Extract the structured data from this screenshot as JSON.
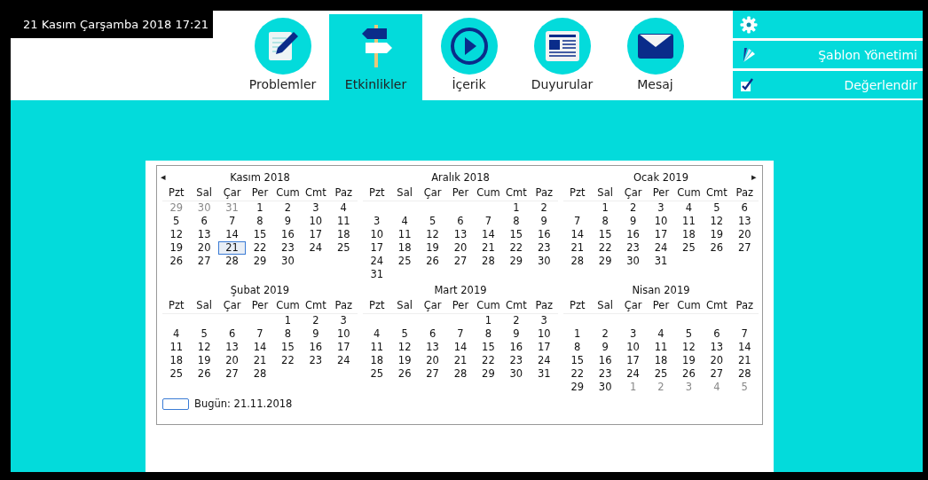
{
  "clock": "21 Kasım Çarşamba 2018 17:21",
  "tabs": [
    {
      "label": "Problemler",
      "kind": "pencil",
      "selected": false
    },
    {
      "label": "Etkinlikler",
      "kind": "signpost",
      "selected": true
    },
    {
      "label": "İçerik",
      "kind": "play",
      "selected": false
    },
    {
      "label": "Duyurular",
      "kind": "news",
      "selected": false
    },
    {
      "label": "Mesaj",
      "kind": "mail",
      "selected": false
    }
  ],
  "side_menu": [
    {
      "kind": "gear"
    },
    {
      "kind": "palette",
      "label": "Şablon Yönetimi"
    },
    {
      "kind": "check",
      "label": "Değerlendir"
    }
  ],
  "calendar": {
    "prev": "◂",
    "next": "▸",
    "today_label": "Bugün: 21.11.2018",
    "months": [
      {
        "title": "Kasım 2018",
        "weekdays": [
          "Pzt",
          "Sal",
          "Çar",
          "Per",
          "Cum",
          "Cmt",
          "Paz"
        ],
        "weeks": [
          {
            "cells": [
              {
                "day": "29",
                "kind": "other"
              },
              {
                "day": "30",
                "kind": "other"
              },
              {
                "day": "31",
                "kind": "other"
              },
              {
                "day": "1",
                "kind": "day"
              },
              {
                "day": "2",
                "kind": "day"
              },
              {
                "day": "3",
                "kind": "day"
              },
              {
                "day": "4",
                "kind": "day"
              }
            ]
          },
          {
            "cells": [
              {
                "day": "5",
                "kind": "day"
              },
              {
                "day": "6",
                "kind": "day"
              },
              {
                "day": "7",
                "kind": "day"
              },
              {
                "day": "8",
                "kind": "day"
              },
              {
                "day": "9",
                "kind": "day"
              },
              {
                "day": "10",
                "kind": "day"
              },
              {
                "day": "11",
                "kind": "day"
              }
            ]
          },
          {
            "cells": [
              {
                "day": "12",
                "kind": "day"
              },
              {
                "day": "13",
                "kind": "day"
              },
              {
                "day": "14",
                "kind": "day"
              },
              {
                "day": "15",
                "kind": "day"
              },
              {
                "day": "16",
                "kind": "day"
              },
              {
                "day": "17",
                "kind": "day"
              },
              {
                "day": "18",
                "kind": "day"
              }
            ]
          },
          {
            "cells": [
              {
                "day": "19",
                "kind": "day"
              },
              {
                "day": "20",
                "kind": "day"
              },
              {
                "day": "21",
                "kind": "today"
              },
              {
                "day": "22",
                "kind": "day"
              },
              {
                "day": "23",
                "kind": "day"
              },
              {
                "day": "24",
                "kind": "day"
              },
              {
                "day": "25",
                "kind": "day"
              }
            ]
          },
          {
            "cells": [
              {
                "day": "26",
                "kind": "day"
              },
              {
                "day": "27",
                "kind": "day"
              },
              {
                "day": "28",
                "kind": "day"
              },
              {
                "day": "29",
                "kind": "day"
              },
              {
                "day": "30",
                "kind": "day"
              },
              {
                "kind": "blank"
              },
              {
                "kind": "blank"
              }
            ]
          }
        ]
      },
      {
        "title": "Aralık 2018",
        "weekdays": [
          "Pzt",
          "Sal",
          "Çar",
          "Per",
          "Cum",
          "Cmt",
          "Paz"
        ],
        "weeks": [
          {
            "cells": [
              {
                "kind": "blank"
              },
              {
                "kind": "blank"
              },
              {
                "kind": "blank"
              },
              {
                "kind": "blank"
              },
              {
                "kind": "blank"
              },
              {
                "day": "1",
                "kind": "day"
              },
              {
                "day": "2",
                "kind": "day"
              }
            ]
          },
          {
            "cells": [
              {
                "day": "3",
                "kind": "day"
              },
              {
                "day": "4",
                "kind": "day"
              },
              {
                "day": "5",
                "kind": "day"
              },
              {
                "day": "6",
                "kind": "day"
              },
              {
                "day": "7",
                "kind": "day"
              },
              {
                "day": "8",
                "kind": "day"
              },
              {
                "day": "9",
                "kind": "day"
              }
            ]
          },
          {
            "cells": [
              {
                "day": "10",
                "kind": "day"
              },
              {
                "day": "11",
                "kind": "day"
              },
              {
                "day": "12",
                "kind": "day"
              },
              {
                "day": "13",
                "kind": "day"
              },
              {
                "day": "14",
                "kind": "day"
              },
              {
                "day": "15",
                "kind": "day"
              },
              {
                "day": "16",
                "kind": "day"
              }
            ]
          },
          {
            "cells": [
              {
                "day": "17",
                "kind": "day"
              },
              {
                "day": "18",
                "kind": "day"
              },
              {
                "day": "19",
                "kind": "day"
              },
              {
                "day": "20",
                "kind": "day"
              },
              {
                "day": "21",
                "kind": "day"
              },
              {
                "day": "22",
                "kind": "day"
              },
              {
                "day": "23",
                "kind": "day"
              }
            ]
          },
          {
            "cells": [
              {
                "day": "24",
                "kind": "day"
              },
              {
                "day": "25",
                "kind": "day"
              },
              {
                "day": "26",
                "kind": "day"
              },
              {
                "day": "27",
                "kind": "day"
              },
              {
                "day": "28",
                "kind": "day"
              },
              {
                "day": "29",
                "kind": "day"
              },
              {
                "day": "30",
                "kind": "day"
              }
            ]
          },
          {
            "cells": [
              {
                "day": "31",
                "kind": "day"
              },
              {
                "kind": "blank"
              },
              {
                "kind": "blank"
              },
              {
                "kind": "blank"
              },
              {
                "kind": "blank"
              },
              {
                "kind": "blank"
              },
              {
                "kind": "blank"
              }
            ]
          }
        ]
      },
      {
        "title": "Ocak 2019",
        "weekdays": [
          "Pzt",
          "Sal",
          "Çar",
          "Per",
          "Cum",
          "Cmt",
          "Paz"
        ],
        "weeks": [
          {
            "cells": [
              {
                "kind": "blank"
              },
              {
                "day": "1",
                "kind": "day"
              },
              {
                "day": "2",
                "kind": "day"
              },
              {
                "day": "3",
                "kind": "day"
              },
              {
                "day": "4",
                "kind": "day"
              },
              {
                "day": "5",
                "kind": "day"
              },
              {
                "day": "6",
                "kind": "day"
              }
            ]
          },
          {
            "cells": [
              {
                "day": "7",
                "kind": "day"
              },
              {
                "day": "8",
                "kind": "day"
              },
              {
                "day": "9",
                "kind": "day"
              },
              {
                "day": "10",
                "kind": "day"
              },
              {
                "day": "11",
                "kind": "day"
              },
              {
                "day": "12",
                "kind": "day"
              },
              {
                "day": "13",
                "kind": "day"
              }
            ]
          },
          {
            "cells": [
              {
                "day": "14",
                "kind": "day"
              },
              {
                "day": "15",
                "kind": "day"
              },
              {
                "day": "16",
                "kind": "day"
              },
              {
                "day": "17",
                "kind": "day"
              },
              {
                "day": "18",
                "kind": "day"
              },
              {
                "day": "19",
                "kind": "day"
              },
              {
                "day": "20",
                "kind": "day"
              }
            ]
          },
          {
            "cells": [
              {
                "day": "21",
                "kind": "day"
              },
              {
                "day": "22",
                "kind": "day"
              },
              {
                "day": "23",
                "kind": "day"
              },
              {
                "day": "24",
                "kind": "day"
              },
              {
                "day": "25",
                "kind": "day"
              },
              {
                "day": "26",
                "kind": "day"
              },
              {
                "day": "27",
                "kind": "day"
              }
            ]
          },
          {
            "cells": [
              {
                "day": "28",
                "kind": "day"
              },
              {
                "day": "29",
                "kind": "day"
              },
              {
                "day": "30",
                "kind": "day"
              },
              {
                "day": "31",
                "kind": "day"
              },
              {
                "kind": "blank"
              },
              {
                "kind": "blank"
              },
              {
                "kind": "blank"
              }
            ]
          }
        ]
      },
      {
        "title": "Şubat 2019",
        "weekdays": [
          "Pzt",
          "Sal",
          "Çar",
          "Per",
          "Cum",
          "Cmt",
          "Paz"
        ],
        "weeks": [
          {
            "cells": [
              {
                "kind": "blank"
              },
              {
                "kind": "blank"
              },
              {
                "kind": "blank"
              },
              {
                "kind": "blank"
              },
              {
                "day": "1",
                "kind": "day"
              },
              {
                "day": "2",
                "kind": "day"
              },
              {
                "day": "3",
                "kind": "day"
              }
            ]
          },
          {
            "cells": [
              {
                "day": "4",
                "kind": "day"
              },
              {
                "day": "5",
                "kind": "day"
              },
              {
                "day": "6",
                "kind": "day"
              },
              {
                "day": "7",
                "kind": "day"
              },
              {
                "day": "8",
                "kind": "day"
              },
              {
                "day": "9",
                "kind": "day"
              },
              {
                "day": "10",
                "kind": "day"
              }
            ]
          },
          {
            "cells": [
              {
                "day": "11",
                "kind": "day"
              },
              {
                "day": "12",
                "kind": "day"
              },
              {
                "day": "13",
                "kind": "day"
              },
              {
                "day": "14",
                "kind": "day"
              },
              {
                "day": "15",
                "kind": "day"
              },
              {
                "day": "16",
                "kind": "day"
              },
              {
                "day": "17",
                "kind": "day"
              }
            ]
          },
          {
            "cells": [
              {
                "day": "18",
                "kind": "day"
              },
              {
                "day": "19",
                "kind": "day"
              },
              {
                "day": "20",
                "kind": "day"
              },
              {
                "day": "21",
                "kind": "day"
              },
              {
                "day": "22",
                "kind": "day"
              },
              {
                "day": "23",
                "kind": "day"
              },
              {
                "day": "24",
                "kind": "day"
              }
            ]
          },
          {
            "cells": [
              {
                "day": "25",
                "kind": "day"
              },
              {
                "day": "26",
                "kind": "day"
              },
              {
                "day": "27",
                "kind": "day"
              },
              {
                "day": "28",
                "kind": "day"
              },
              {
                "kind": "blank"
              },
              {
                "kind": "blank"
              },
              {
                "kind": "blank"
              }
            ]
          }
        ]
      },
      {
        "title": "Mart 2019",
        "weekdays": [
          "Pzt",
          "Sal",
          "Çar",
          "Per",
          "Cum",
          "Cmt",
          "Paz"
        ],
        "weeks": [
          {
            "cells": [
              {
                "kind": "blank"
              },
              {
                "kind": "blank"
              },
              {
                "kind": "blank"
              },
              {
                "kind": "blank"
              },
              {
                "day": "1",
                "kind": "day"
              },
              {
                "day": "2",
                "kind": "day"
              },
              {
                "day": "3",
                "kind": "day"
              }
            ]
          },
          {
            "cells": [
              {
                "day": "4",
                "kind": "day"
              },
              {
                "day": "5",
                "kind": "day"
              },
              {
                "day": "6",
                "kind": "day"
              },
              {
                "day": "7",
                "kind": "day"
              },
              {
                "day": "8",
                "kind": "day"
              },
              {
                "day": "9",
                "kind": "day"
              },
              {
                "day": "10",
                "kind": "day"
              }
            ]
          },
          {
            "cells": [
              {
                "day": "11",
                "kind": "day"
              },
              {
                "day": "12",
                "kind": "day"
              },
              {
                "day": "13",
                "kind": "day"
              },
              {
                "day": "14",
                "kind": "day"
              },
              {
                "day": "15",
                "kind": "day"
              },
              {
                "day": "16",
                "kind": "day"
              },
              {
                "day": "17",
                "kind": "day"
              }
            ]
          },
          {
            "cells": [
              {
                "day": "18",
                "kind": "day"
              },
              {
                "day": "19",
                "kind": "day"
              },
              {
                "day": "20",
                "kind": "day"
              },
              {
                "day": "21",
                "kind": "day"
              },
              {
                "day": "22",
                "kind": "day"
              },
              {
                "day": "23",
                "kind": "day"
              },
              {
                "day": "24",
                "kind": "day"
              }
            ]
          },
          {
            "cells": [
              {
                "day": "25",
                "kind": "day"
              },
              {
                "day": "26",
                "kind": "day"
              },
              {
                "day": "27",
                "kind": "day"
              },
              {
                "day": "28",
                "kind": "day"
              },
              {
                "day": "29",
                "kind": "day"
              },
              {
                "day": "30",
                "kind": "day"
              },
              {
                "day": "31",
                "kind": "day"
              }
            ]
          }
        ]
      },
      {
        "title": "Nisan 2019",
        "weekdays": [
          "Pzt",
          "Sal",
          "Çar",
          "Per",
          "Cum",
          "Cmt",
          "Paz"
        ],
        "weeks": [
          {
            "cells": [
              {
                "kind": "blank"
              },
              {
                "kind": "blank"
              },
              {
                "kind": "blank"
              },
              {
                "kind": "blank"
              },
              {
                "kind": "blank"
              },
              {
                "kind": "blank"
              },
              {
                "kind": "blank"
              }
            ]
          },
          {
            "cells": [
              {
                "day": "1",
                "kind": "day"
              },
              {
                "day": "2",
                "kind": "day"
              },
              {
                "day": "3",
                "kind": "day"
              },
              {
                "day": "4",
                "kind": "day"
              },
              {
                "day": "5",
                "kind": "day"
              },
              {
                "day": "6",
                "kind": "day"
              },
              {
                "day": "7",
                "kind": "day"
              }
            ]
          },
          {
            "cells": [
              {
                "day": "8",
                "kind": "day"
              },
              {
                "day": "9",
                "kind": "day"
              },
              {
                "day": "10",
                "kind": "day"
              },
              {
                "day": "11",
                "kind": "day"
              },
              {
                "day": "12",
                "kind": "day"
              },
              {
                "day": "13",
                "kind": "day"
              },
              {
                "day": "14",
                "kind": "day"
              }
            ]
          },
          {
            "cells": [
              {
                "day": "15",
                "kind": "day"
              },
              {
                "day": "16",
                "kind": "day"
              },
              {
                "day": "17",
                "kind": "day"
              },
              {
                "day": "18",
                "kind": "day"
              },
              {
                "day": "19",
                "kind": "day"
              },
              {
                "day": "20",
                "kind": "day"
              },
              {
                "day": "21",
                "kind": "day"
              }
            ]
          },
          {
            "cells": [
              {
                "day": "22",
                "kind": "day"
              },
              {
                "day": "23",
                "kind": "day"
              },
              {
                "day": "24",
                "kind": "day"
              },
              {
                "day": "25",
                "kind": "day"
              },
              {
                "day": "26",
                "kind": "day"
              },
              {
                "day": "27",
                "kind": "day"
              },
              {
                "day": "28",
                "kind": "day"
              }
            ]
          },
          {
            "cells": [
              {
                "day": "29",
                "kind": "day"
              },
              {
                "day": "30",
                "kind": "day"
              },
              {
                "day": "1",
                "kind": "other"
              },
              {
                "day": "2",
                "kind": "other"
              },
              {
                "day": "3",
                "kind": "other"
              },
              {
                "day": "4",
                "kind": "other"
              },
              {
                "day": "5",
                "kind": "other"
              }
            ]
          }
        ]
      }
    ]
  }
}
